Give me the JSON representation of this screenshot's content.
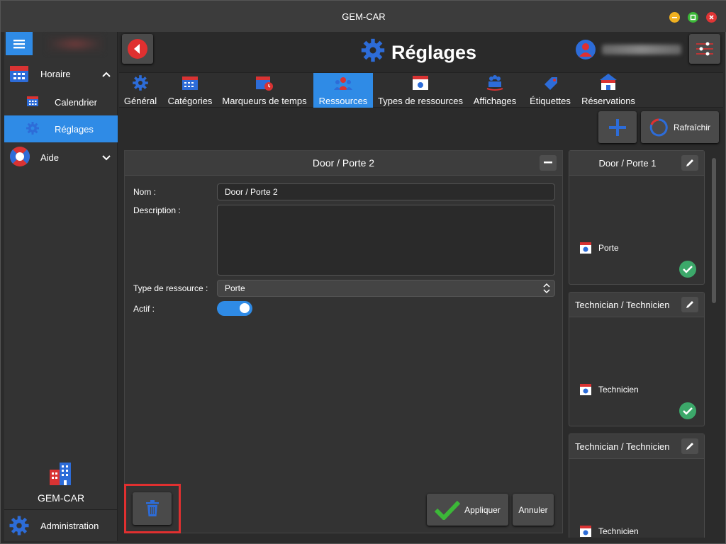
{
  "window": {
    "title": "GEM-CAR"
  },
  "sidebar": {
    "items": [
      {
        "label": "Horaire"
      },
      {
        "label": "Calendrier"
      },
      {
        "label": "Réglages"
      },
      {
        "label": "Aide"
      }
    ],
    "brand": "GEM-CAR",
    "admin": "Administration"
  },
  "header": {
    "title": "Réglages"
  },
  "tabs": [
    {
      "label": "Général"
    },
    {
      "label": "Catégories"
    },
    {
      "label": "Marqueurs de temps"
    },
    {
      "label": "Ressources"
    },
    {
      "label": "Types de ressources"
    },
    {
      "label": "Affichages"
    },
    {
      "label": "Étiquettes"
    },
    {
      "label": "Réservations"
    }
  ],
  "actions": {
    "refresh": "Rafraîchir"
  },
  "form": {
    "title": "Door / Porte 2",
    "name_label": "Nom :",
    "name_value": "Door / Porte 2",
    "description_label": "Description :",
    "description_value": "",
    "type_label": "Type de ressource :",
    "type_value": "Porte",
    "active_label": "Actif :",
    "active": true,
    "apply": "Appliquer",
    "cancel": "Annuler"
  },
  "cards": [
    {
      "title": "Door / Porte 1",
      "type": "Porte",
      "active": true
    },
    {
      "title": "Technician / Technicien",
      "type": "Technicien",
      "active": true
    },
    {
      "title": "Technician / Technicien",
      "type": "Technicien"
    }
  ],
  "colors": {
    "accent": "#2f8be6",
    "danger": "#e03030",
    "success": "#3ca86a"
  }
}
